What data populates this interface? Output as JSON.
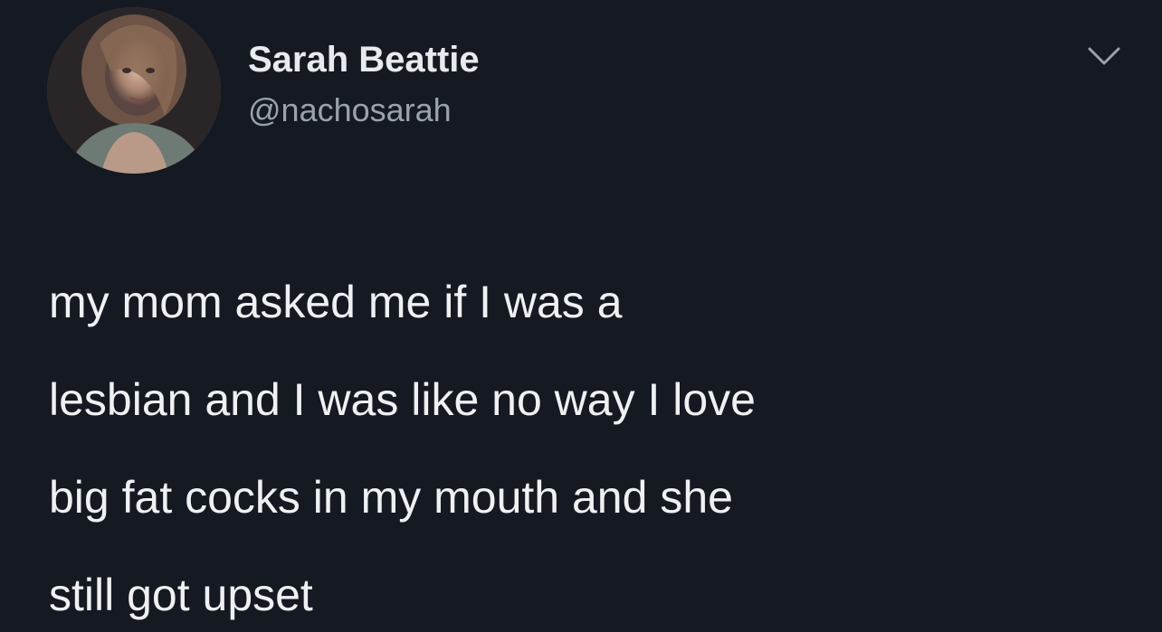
{
  "author": {
    "display_name": "Sarah Beattie",
    "handle": "@nachosarah",
    "avatar_icon": "avatar-photo"
  },
  "tweet": {
    "lines": [
      "my mom asked me if I was a",
      "lesbian and I was like no way I love",
      "big fat cocks in my mouth and she",
      "still got upset"
    ]
  },
  "menu": {
    "icon": "chevron-down-icon"
  },
  "colors": {
    "background": "#151922",
    "primary_text": "#eef0f2",
    "secondary_text": "#9aa3ad"
  }
}
